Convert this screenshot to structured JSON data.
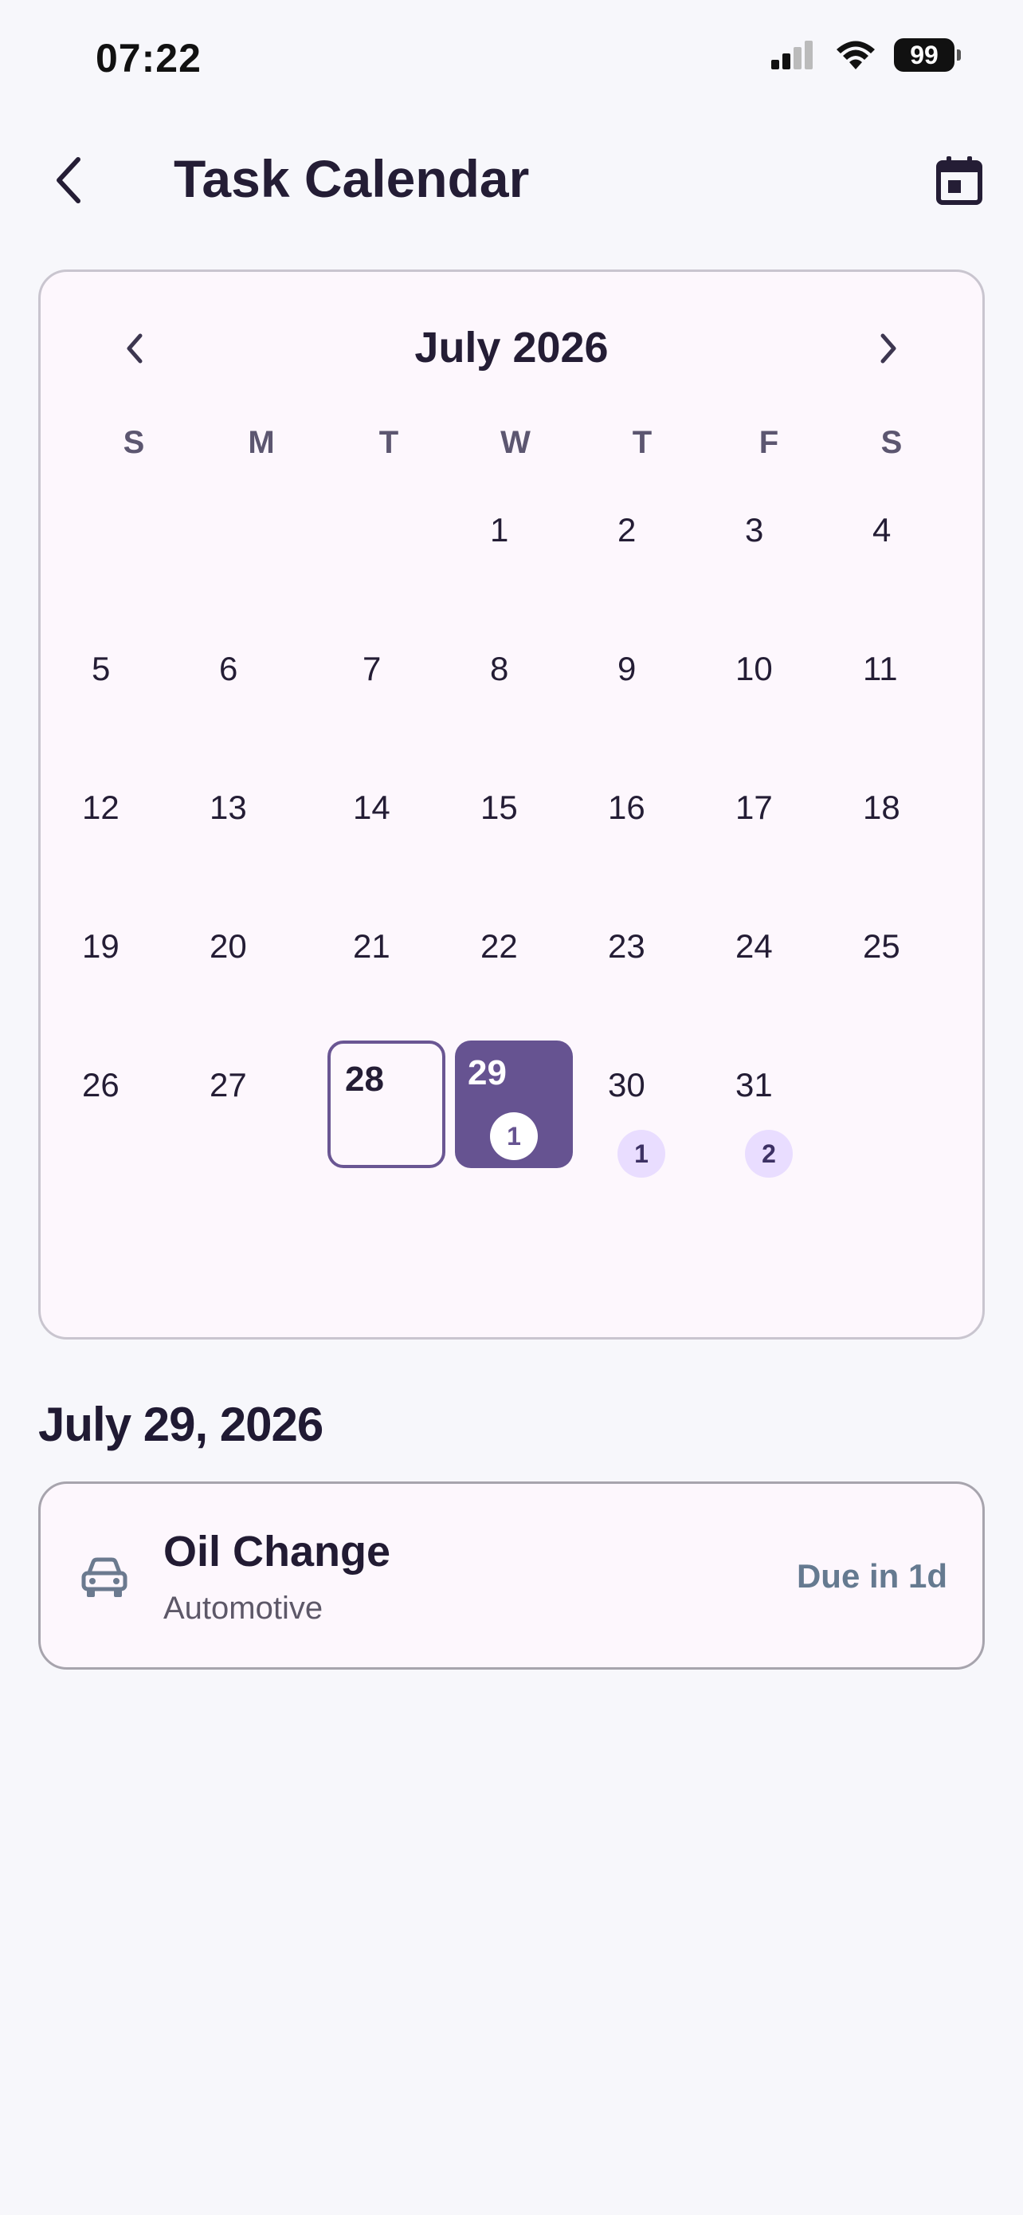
{
  "status_bar": {
    "time": "07:22",
    "battery": "99"
  },
  "app_bar": {
    "title": "Task Calendar"
  },
  "calendar": {
    "month_title": "July 2026",
    "weekdays": [
      "S",
      "M",
      "T",
      "W",
      "T",
      "F",
      "S"
    ],
    "days": [
      {
        "num": "1"
      },
      {
        "num": "2"
      },
      {
        "num": "3"
      },
      {
        "num": "4"
      },
      {
        "num": "5"
      },
      {
        "num": "6"
      },
      {
        "num": "7"
      },
      {
        "num": "8"
      },
      {
        "num": "9"
      },
      {
        "num": "10"
      },
      {
        "num": "11"
      },
      {
        "num": "12"
      },
      {
        "num": "13"
      },
      {
        "num": "14"
      },
      {
        "num": "15"
      },
      {
        "num": "16"
      },
      {
        "num": "17"
      },
      {
        "num": "18"
      },
      {
        "num": "19"
      },
      {
        "num": "20"
      },
      {
        "num": "21"
      },
      {
        "num": "22"
      },
      {
        "num": "23"
      },
      {
        "num": "24"
      },
      {
        "num": "25"
      },
      {
        "num": "26"
      },
      {
        "num": "27"
      },
      {
        "num": "28",
        "state": "today"
      },
      {
        "num": "29",
        "state": "selected",
        "count": "1"
      },
      {
        "num": "30",
        "count": "1"
      },
      {
        "num": "31",
        "count": "2"
      }
    ]
  },
  "selected_date_label": "July 29, 2026",
  "tasks": [
    {
      "title": "Oil Change",
      "category": "Automotive",
      "due": "Due in 1d",
      "icon": "car-icon"
    }
  ],
  "colors": {
    "accent": "#665391",
    "badge_bg": "#e9ddff",
    "due_text": "#657a90"
  }
}
